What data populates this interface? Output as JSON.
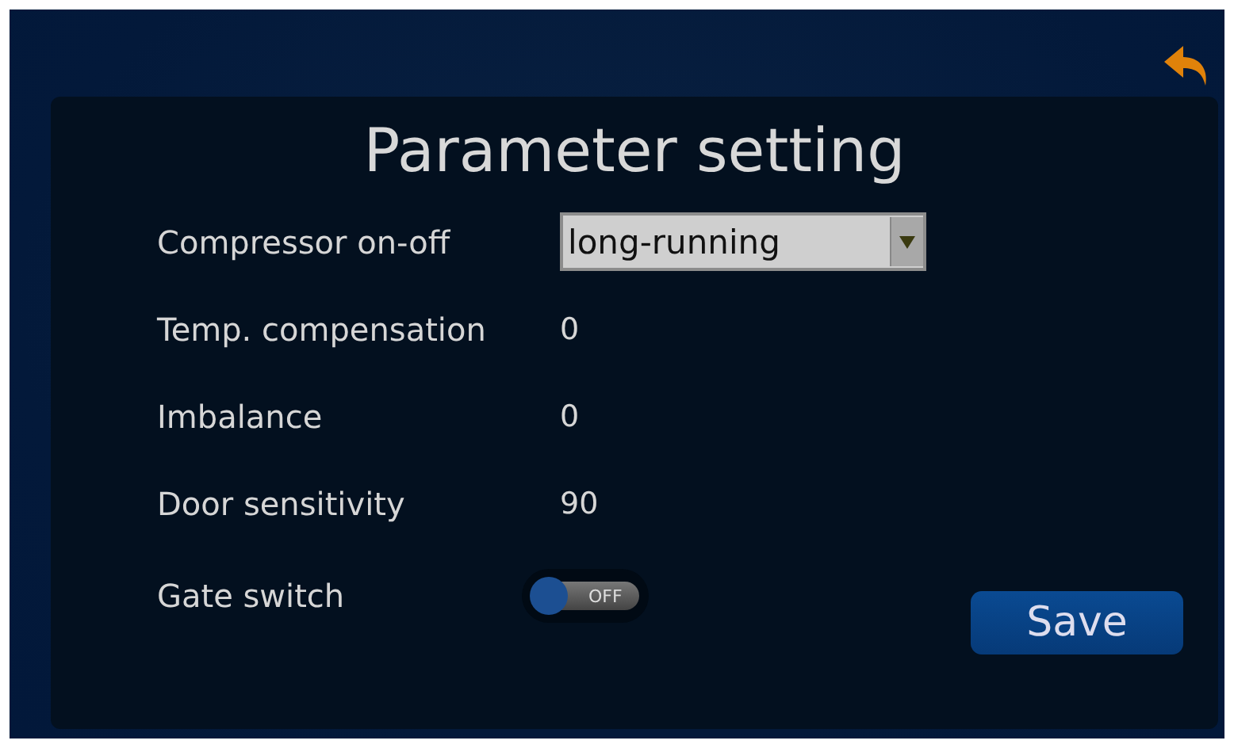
{
  "title": "Parameter setting",
  "rows": [
    {
      "kind": "dropdown",
      "label": "Compressor on-off",
      "value": "long-running"
    },
    {
      "kind": "value",
      "label": "Temp. compensation",
      "value": "0"
    },
    {
      "kind": "value",
      "label": "Imbalance",
      "value": "0"
    },
    {
      "kind": "value",
      "label": "Door sensitivity",
      "value": "90"
    },
    {
      "kind": "toggle",
      "label": "Gate switch",
      "on": false,
      "state_text": "OFF"
    }
  ],
  "save_button": "Save"
}
